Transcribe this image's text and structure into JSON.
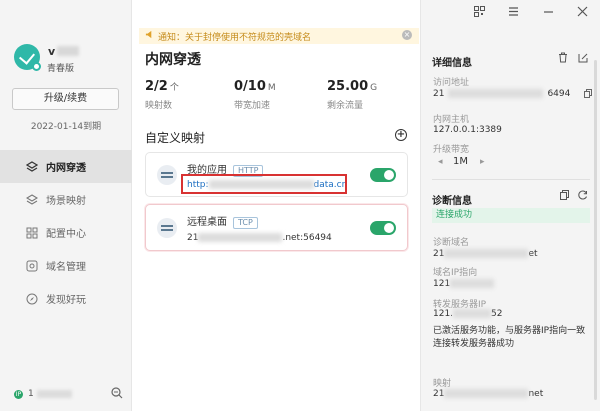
{
  "sidebar": {
    "username": "v",
    "edition": "青春版",
    "upgrade_label": "升级/续费",
    "expiry": "2022-01-14到期",
    "nav": [
      {
        "label": "内网穿透",
        "icon": "tunnel-icon"
      },
      {
        "label": "场景映射",
        "icon": "scene-icon"
      },
      {
        "label": "配置中心",
        "icon": "grid-icon"
      },
      {
        "label": "域名管理",
        "icon": "globe-icon"
      },
      {
        "label": "发现好玩",
        "icon": "compass-icon"
      }
    ],
    "footer_ip_badge": "IP",
    "footer_ip": "1"
  },
  "notice": {
    "text": "通知：关于封停使用不符规范的壳域名"
  },
  "main": {
    "title": "内网穿透",
    "stats": [
      {
        "value": "2/2",
        "unit": "个",
        "label": "映射数"
      },
      {
        "value": "0/10",
        "unit": "M",
        "label": "带宽加速"
      },
      {
        "value": "25.00",
        "unit": "G",
        "label": "剩余流量"
      }
    ],
    "section_title": "自定义映射",
    "mappings": [
      {
        "name": "我的应用",
        "protocol": "HTTP",
        "address_prefix": "http:",
        "address_suffix": "data.cn",
        "enabled": true
      },
      {
        "name": "远程桌面",
        "protocol": "TCP",
        "address_prefix": "21",
        "address_suffix": ".net:56494",
        "enabled": true
      }
    ]
  },
  "details": {
    "title": "详细信息",
    "access_label": "访问地址",
    "access_prefix": "21",
    "access_suffix": "6494",
    "host_label": "内网主机",
    "host_value": "127.0.0.1:3389",
    "bandwidth_label": "升级带宽",
    "bandwidth_value": "1M"
  },
  "diagnosis": {
    "title": "诊断信息",
    "status": "连接成功",
    "domain_label": "诊断域名",
    "domain_prefix": "21",
    "domain_suffix": "et",
    "ip_label": "域名IP指向",
    "ip_prefix": "121",
    "ip_suffix": "",
    "forward_label": "转发服务器IP",
    "forward_prefix": "121.",
    "forward_suffix": "52",
    "description": "已激活服务功能，与服务器IP指向一致连接转发服务器成功",
    "mapping_label": "映射",
    "mapping_prefix": "21",
    "mapping_suffix": "net"
  }
}
